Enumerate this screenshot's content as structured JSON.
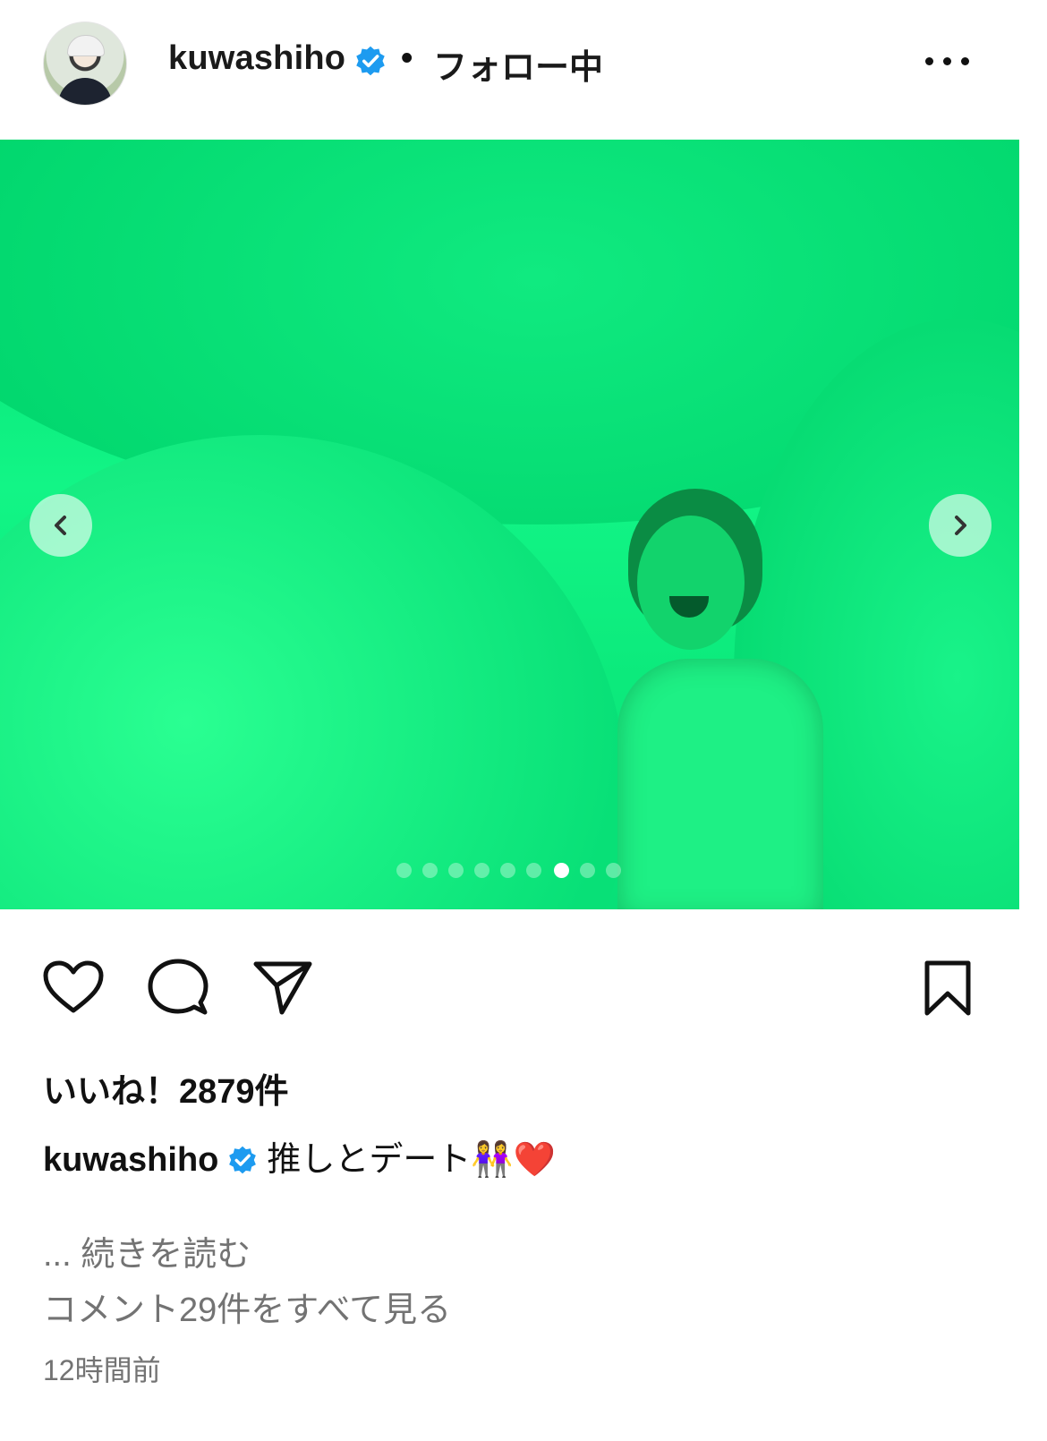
{
  "header": {
    "username": "kuwashiho",
    "separator": "•",
    "follow_status": "フォロー中",
    "more_icon": "more-horizontal-icon"
  },
  "post": {
    "carousel": {
      "total_slides": 9,
      "active_slide": 7,
      "prev_icon": "chevron-left-icon",
      "next_icon": "chevron-right-icon"
    }
  },
  "actions": {
    "like_icon": "heart-icon",
    "comment_icon": "comment-bubble-icon",
    "share_icon": "paper-plane-icon",
    "save_icon": "bookmark-icon"
  },
  "likes_text": "いいね！2879件",
  "caption": {
    "username": "kuwashiho",
    "text": "推しとデート👭❤️"
  },
  "read_more": "... 続きを読む",
  "view_comments": "コメント29件をすべて見る",
  "timestamp": "12時間前",
  "colors": {
    "verified": "#1d9bf0",
    "photo_tint": "#12f586",
    "muted_text": "#737373"
  }
}
